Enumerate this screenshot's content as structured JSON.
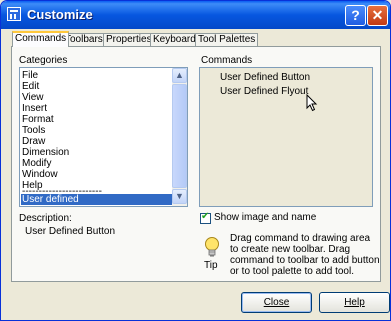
{
  "window": {
    "title": "Customize",
    "help_glyph": "?",
    "close_glyph": "✕"
  },
  "tabs": [
    "Commands",
    "Toolbars",
    "Properties",
    "Keyboard",
    "Tool Palettes"
  ],
  "categories": {
    "label": "Categories",
    "items": [
      "File",
      "Edit",
      "View",
      "Insert",
      "Format",
      "Tools",
      "Draw",
      "Dimension",
      "Modify",
      "Window",
      "Help",
      "------------------------",
      "User defined"
    ],
    "selected": "User defined"
  },
  "commands": {
    "label": "Commands",
    "items": [
      "User Defined Button",
      "User Defined Flyout"
    ]
  },
  "description": {
    "label": "Description:",
    "text": "User Defined Button"
  },
  "show_image": {
    "label": "Show image and name",
    "checked": true
  },
  "tip": {
    "label": "Tip",
    "text": "Drag command to drawing area to create new toolbar. Drag command to toolbar to add button or to tool palette to add tool."
  },
  "buttons": {
    "close": "Close",
    "help": "Help"
  },
  "icons": {
    "app": "customize-app-icon",
    "tip": "lightbulb-icon",
    "cursor": "mouse-pointer-icon"
  }
}
